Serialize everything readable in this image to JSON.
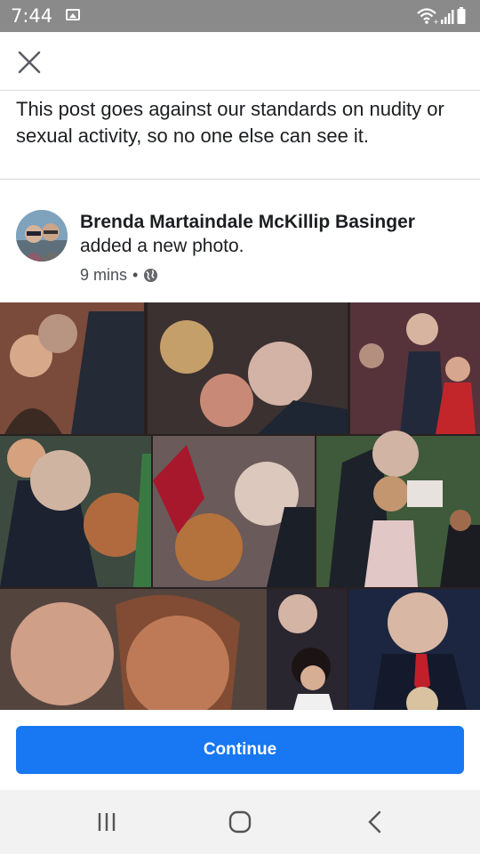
{
  "status_bar": {
    "time": "7:44",
    "icons": [
      "gallery-icon",
      "wifi-icon",
      "signal-icon",
      "battery-icon"
    ]
  },
  "top_bar": {
    "close_icon": "close-icon"
  },
  "notice": {
    "text": "This post goes against our standards on nudity or sexual activity, so no one else can see it."
  },
  "post": {
    "author": "Brenda Martaindale McKillip Basinger",
    "action": "added a new photo.",
    "time": "9 mins",
    "separator": "•",
    "audience_icon": "globe-icon"
  },
  "footer": {
    "continue_label": "Continue"
  },
  "nav_bar": {
    "buttons": [
      "recent-apps-icon",
      "home-icon",
      "back-icon"
    ]
  },
  "colors": {
    "accent": "#1877f2",
    "status_bar": "#8a8a8a",
    "nav_bar": "#f2f2f2"
  }
}
